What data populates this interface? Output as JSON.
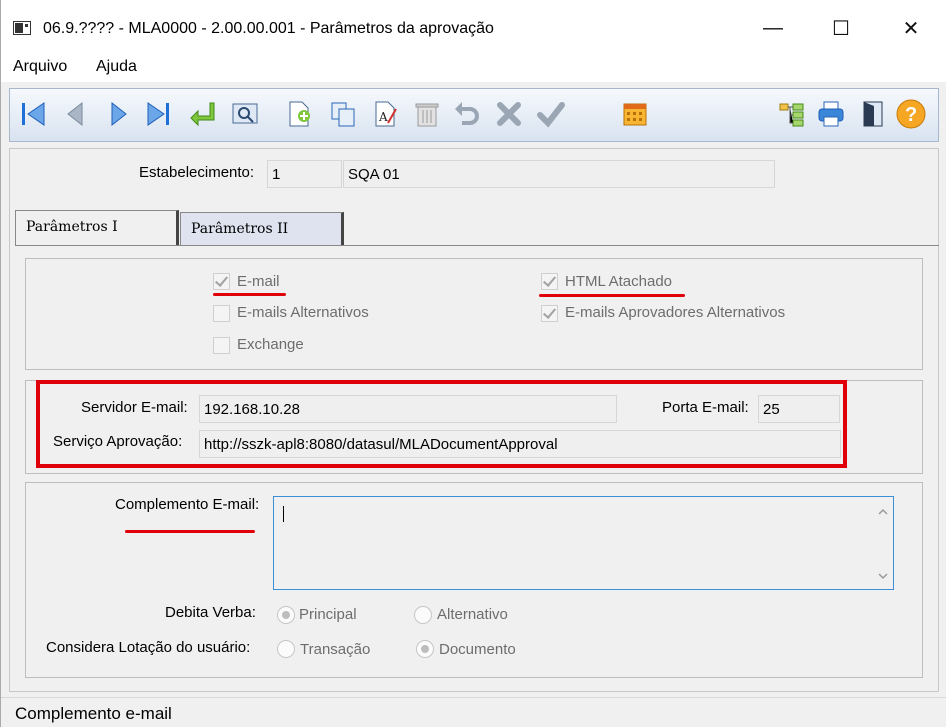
{
  "window": {
    "title": "06.9.???? - MLA0000 - 2.00.00.001 - Parâmetros da aprovação",
    "minimize": "—",
    "maximize": "☐",
    "close": "✕"
  },
  "menu": {
    "items": [
      "Arquivo",
      "Ajuda"
    ]
  },
  "toolbar": {
    "icons": [
      "first-icon",
      "prev-icon",
      "next-icon",
      "last-icon",
      "goto-icon",
      "search-icon",
      "add-icon",
      "copy-icon",
      "edit-icon",
      "delete-icon",
      "undo-icon",
      "cancel-icon",
      "ok-icon",
      "calendar-icon",
      "tree-icon",
      "print-icon",
      "exit-icon",
      "help-icon"
    ],
    "accent": "#1f6fd6",
    "help_label": "?"
  },
  "header": {
    "estab_label": "Estabelecimento:",
    "estab_code": "1",
    "estab_name": "SQA 01"
  },
  "tabs": [
    {
      "label": "Parâmetros I",
      "active": true
    },
    {
      "label": "Parâmetros II",
      "active": false
    }
  ],
  "checkboxes": {
    "email": {
      "label": "E-mail",
      "checked": true
    },
    "emails_alt": {
      "label": "E-mails Alternativos",
      "checked": false
    },
    "exchange": {
      "label": "Exchange",
      "checked": false
    },
    "html_attached": {
      "label": "HTML Atachado",
      "checked": true
    },
    "emails_aprov_alt": {
      "label": "E-mails Aprovadores Alternativos",
      "checked": true
    }
  },
  "server": {
    "server_label": "Servidor E-mail:",
    "server_value": "192.168.10.28",
    "port_label": "Porta E-mail:",
    "port_value": "25",
    "service_label": "Serviço Aprovação:",
    "service_value": "http://sszk-apl8:8080/datasul/MLADocumentApproval"
  },
  "complement": {
    "label": "Complemento E-mail:",
    "value": ""
  },
  "debita": {
    "label": "Debita Verba:",
    "options": [
      "Principal",
      "Alternativo"
    ],
    "selected": "Principal"
  },
  "considera": {
    "label": "Considera Lotação do usuário:",
    "options": [
      "Transação",
      "Documento"
    ],
    "selected": "Documento"
  },
  "status": {
    "text": "Complemento e-mail"
  },
  "colors": {
    "highlight": "#e0000a",
    "focus_border": "#3b8fd7"
  }
}
